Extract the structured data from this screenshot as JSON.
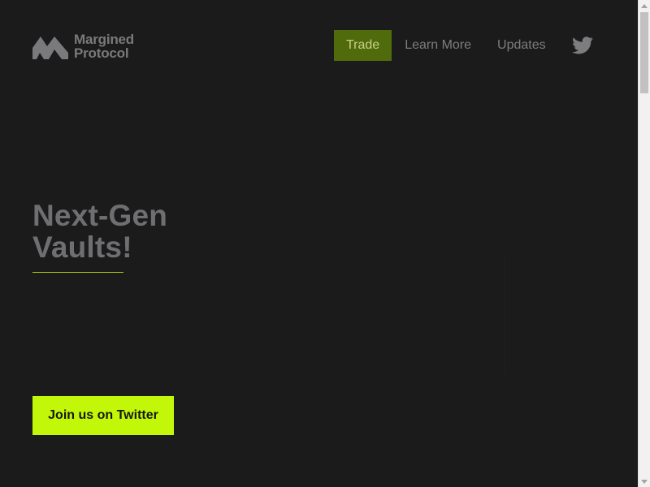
{
  "brand": {
    "name_line1": "Margined",
    "name_line2": "Protocol"
  },
  "nav": {
    "items": [
      {
        "label": "Trade",
        "active": true
      },
      {
        "label": "Learn More",
        "active": false
      },
      {
        "label": "Updates",
        "active": false
      }
    ],
    "social_icon": "twitter-icon"
  },
  "hero": {
    "title_line1": "Next-Gen",
    "title_line2": "Vaults!",
    "cta_label": "Join us on Twitter"
  },
  "colors": {
    "background": "#1b1b1c",
    "accent": "#c3f70a",
    "nav_active_bg": "#4f6b0b",
    "muted_text": "#7d7d80"
  },
  "scrollbar": {
    "scroll_position": 0
  }
}
